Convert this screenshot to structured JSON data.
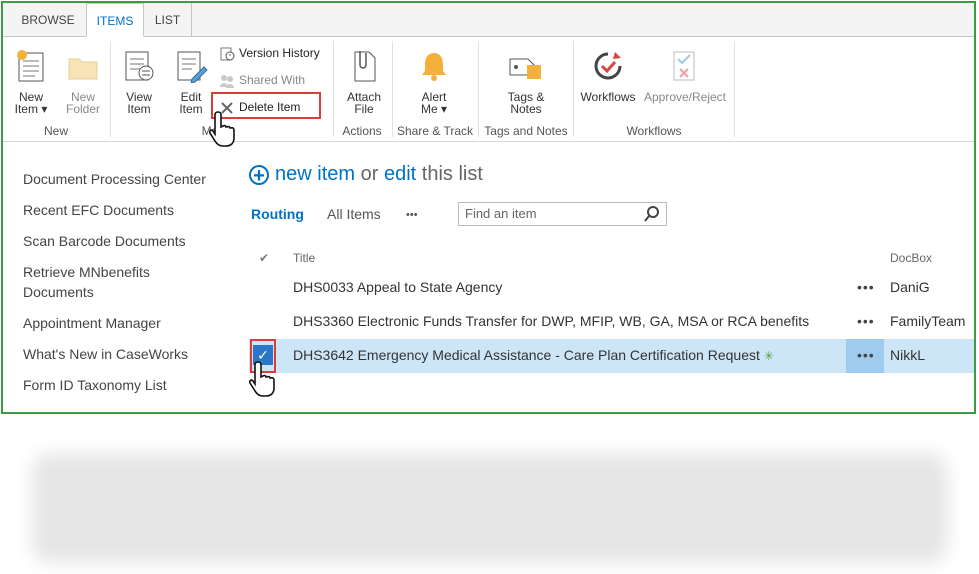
{
  "tabs": [
    "BROWSE",
    "ITEMS",
    "LIST"
  ],
  "ribbon": {
    "new_item": {
      "line1": "New",
      "line2": "Item ▾"
    },
    "new_folder": {
      "line1": "New",
      "line2": "Folder"
    },
    "view_item": {
      "line1": "View",
      "line2": "Item"
    },
    "edit_item": {
      "line1": "Edit",
      "line2": "Item"
    },
    "version_history": "Version History",
    "shared_with": "Shared With",
    "delete_item": "Delete Item",
    "attach_file": {
      "line1": "Attach",
      "line2": "File"
    },
    "alert_me": {
      "line1": "Alert",
      "line2": "Me ▾"
    },
    "tags_notes": {
      "line1": "Tags &",
      "line2": "Notes"
    },
    "workflows": "Workflows",
    "approve_reject": "Approve/Reject",
    "groups": {
      "new": "New",
      "manage": "Ma",
      "actions": "Actions",
      "share_track": "Share & Track",
      "tags_notes": "Tags and Notes",
      "workflows": "Workflows"
    }
  },
  "nav": [
    "Document Processing Center",
    "Recent EFC Documents",
    "Scan Barcode Documents",
    "Retrieve MNbenefits Documents",
    "Appointment Manager",
    "What's New in CaseWorks",
    "Form ID Taxonomy List"
  ],
  "main": {
    "new_item": "new item",
    "or": "or",
    "edit": "edit",
    "this_list": "this list",
    "views": {
      "routing": "Routing",
      "all_items": "All Items",
      "more": "•••"
    },
    "search_placeholder": "Find an item",
    "columns": {
      "check": "✔",
      "title": "Title",
      "docbox": "DocBox"
    },
    "rows": [
      {
        "title": "DHS0033 Appeal to State Agency",
        "docbox": "DaniG",
        "dots": "•••"
      },
      {
        "title": "DHS3360 Electronic Funds Transfer for DWP, MFIP, WB, GA, MSA or RCA benefits",
        "docbox": "FamilyTeam",
        "dots": "•••"
      },
      {
        "title": "DHS3642 Emergency Medical Assistance - Care Plan Certification Request",
        "docbox": "NikkL",
        "dots": "•••",
        "new_marker": "✳"
      }
    ],
    "checkmark": "✓"
  },
  "colors": {
    "accent": "#0072c6",
    "highlight": "#e03b3b",
    "frame": "#3f9a45",
    "selected_row": "#cde6f7"
  }
}
